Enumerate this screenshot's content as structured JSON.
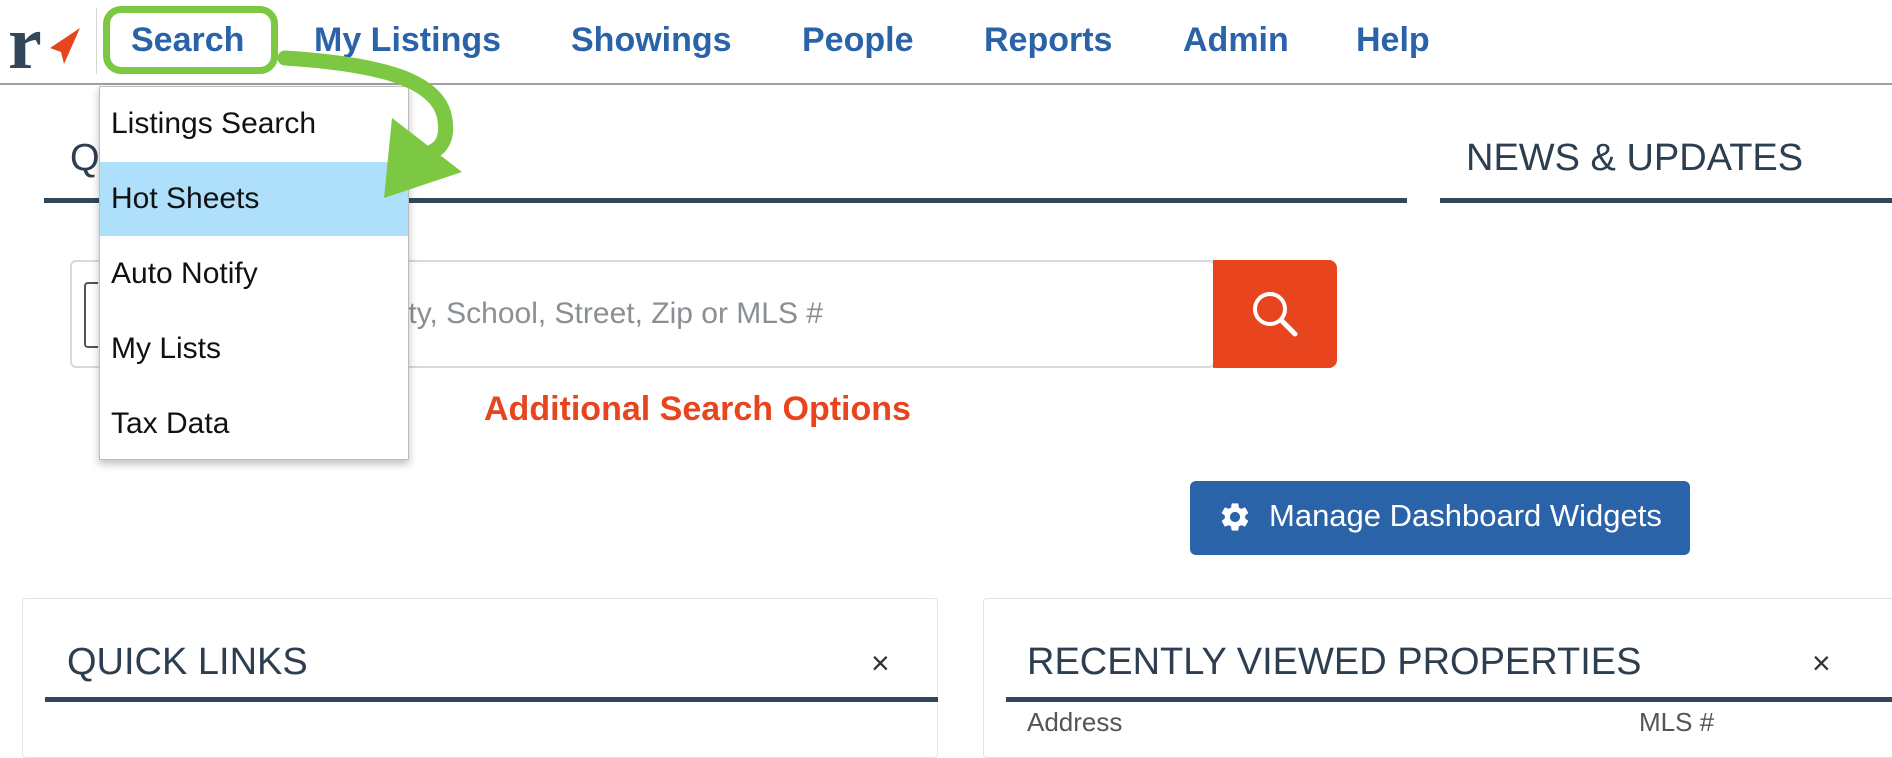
{
  "nav": {
    "items": [
      {
        "id": "search",
        "label": "Search"
      },
      {
        "id": "my-listings",
        "label": "My Listings"
      },
      {
        "id": "showings",
        "label": "Showings"
      },
      {
        "id": "people",
        "label": "People"
      },
      {
        "id": "reports",
        "label": "Reports"
      },
      {
        "id": "admin",
        "label": "Admin"
      },
      {
        "id": "help",
        "label": "Help"
      }
    ],
    "logo_letter": "r"
  },
  "dropdown": {
    "items": [
      {
        "label": "Listings Search",
        "active": false
      },
      {
        "label": "Hot Sheets",
        "active": true
      },
      {
        "label": "Auto Notify",
        "active": false
      },
      {
        "label": "My Lists",
        "active": false
      },
      {
        "label": "Tax Data",
        "active": false
      }
    ]
  },
  "quick_search": {
    "heading_partial": "Q",
    "placeholder": "City, County, School, Street, Zip or MLS #",
    "visible_placeholder": "unty, School, Street, Zip or MLS #",
    "additional_options_label": "Additional Search Options"
  },
  "news": {
    "heading": "NEWS & UPDATES"
  },
  "manage_widgets": {
    "label": "Manage Dashboard Widgets"
  },
  "widgets": {
    "quick_links": {
      "title": "QUICK LINKS",
      "close": "×"
    },
    "recently_viewed": {
      "title": "RECENTLY VIEWED PROPERTIES",
      "close": "×",
      "columns": [
        "Address",
        "MLS #"
      ]
    }
  },
  "colors": {
    "nav_link": "#2a63a8",
    "accent_orange": "#e8441e",
    "highlight_green": "#7cc843",
    "dropdown_active": "#aee0fb",
    "heading_text": "#2d3e50"
  }
}
